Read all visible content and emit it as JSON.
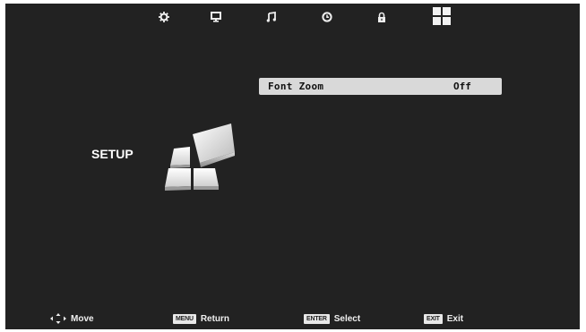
{
  "tabs": [
    {
      "name": "picture-settings-icon"
    },
    {
      "name": "display-icon"
    },
    {
      "name": "sound-icon"
    },
    {
      "name": "time-icon"
    },
    {
      "name": "lock-icon"
    },
    {
      "name": "setup-icon",
      "active": true
    }
  ],
  "section": {
    "title": "SETUP"
  },
  "menu": {
    "items": [
      {
        "label": "Font Zoom",
        "value": "Off",
        "selected": true
      }
    ]
  },
  "hints": {
    "move": {
      "label": "Move"
    },
    "return": {
      "key": "MENU",
      "label": "Return"
    },
    "select": {
      "key": "ENTER",
      "label": "Select"
    },
    "exit": {
      "key": "EXIT",
      "label": "Exit"
    }
  },
  "colors": {
    "background": "#222222",
    "highlight": "#d9d9d9",
    "text": "#ffffff"
  }
}
